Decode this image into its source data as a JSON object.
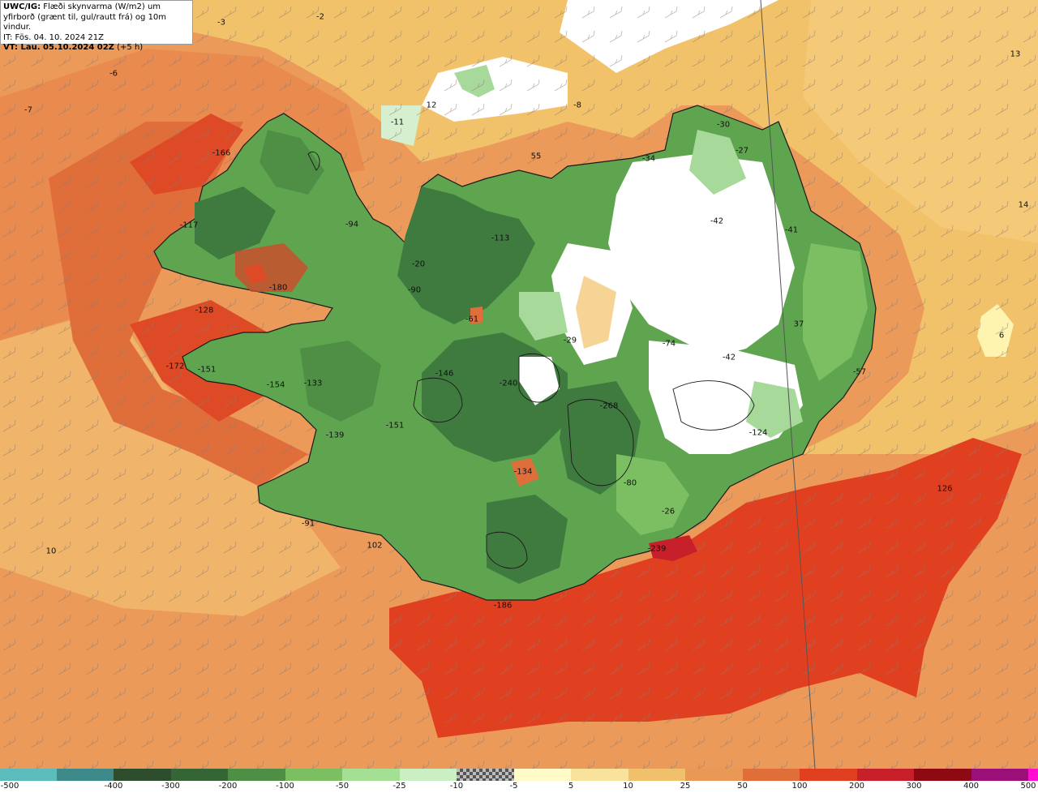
{
  "header": {
    "line1_bold": "UWC/IG:",
    "line1": " Flæði skynvarma (W/m2) um",
    "line2": "yfirborð (grænt til, gul/rautt frá) og 10m vindur.",
    "line3": "IT: Fös. 04. 10. 2024 21Z",
    "line4_bold": "VT: Lau. 05.10.2024 02Z",
    "line4": " (+5 h)"
  },
  "colors": {
    "sea_far": "#f2c26a",
    "sea_mid": "#eb9a5a",
    "sea_hot": "#e05a30",
    "sea_hotter": "#d43a22",
    "land_dark": "#3f7a3f",
    "land_mid": "#5fa54f",
    "land_light": "#a6d99a",
    "land_white": "#ffffff",
    "coast": "#1a1a1a"
  },
  "map_values": [
    "-3",
    "-2",
    "-6",
    "-7",
    "12",
    "-11",
    "-8",
    "13",
    "-30",
    "-27",
    "55",
    "-34",
    "-166",
    "-117",
    "-94",
    "-113",
    "-42",
    "-41",
    "14",
    "-20",
    "-180",
    "-90",
    "-128",
    "-61",
    "37",
    "6",
    "-29",
    "-74",
    "-42",
    "-172",
    "-151",
    "-146",
    "-240",
    "-133",
    "-154",
    "-57",
    "-268",
    "-151",
    "-124",
    "-139",
    "-134",
    "-80",
    "126",
    "-91",
    "-26",
    "10",
    "102",
    "-239",
    "-186"
  ],
  "legend": {
    "colors": [
      "#5cbcbc",
      "#3e8a8a",
      "#2d4d2d",
      "#356535",
      "#4f8f45",
      "#7cbf63",
      "#a4df93",
      "#cbefc2",
      "checker",
      "#fffbc8",
      "#f9e39c",
      "#f1c06d",
      "#e99855",
      "#e06e3b",
      "#e04020",
      "#c8202a",
      "#8e0a12",
      "#9a1078",
      "#ff10d0"
    ],
    "labels": [
      "-500",
      "-400",
      "-300",
      "-200",
      "-100",
      "-50",
      "-25",
      "-10",
      "-5",
      "5",
      "10",
      "25",
      "50",
      "100",
      "200",
      "300",
      "400",
      "500"
    ]
  }
}
